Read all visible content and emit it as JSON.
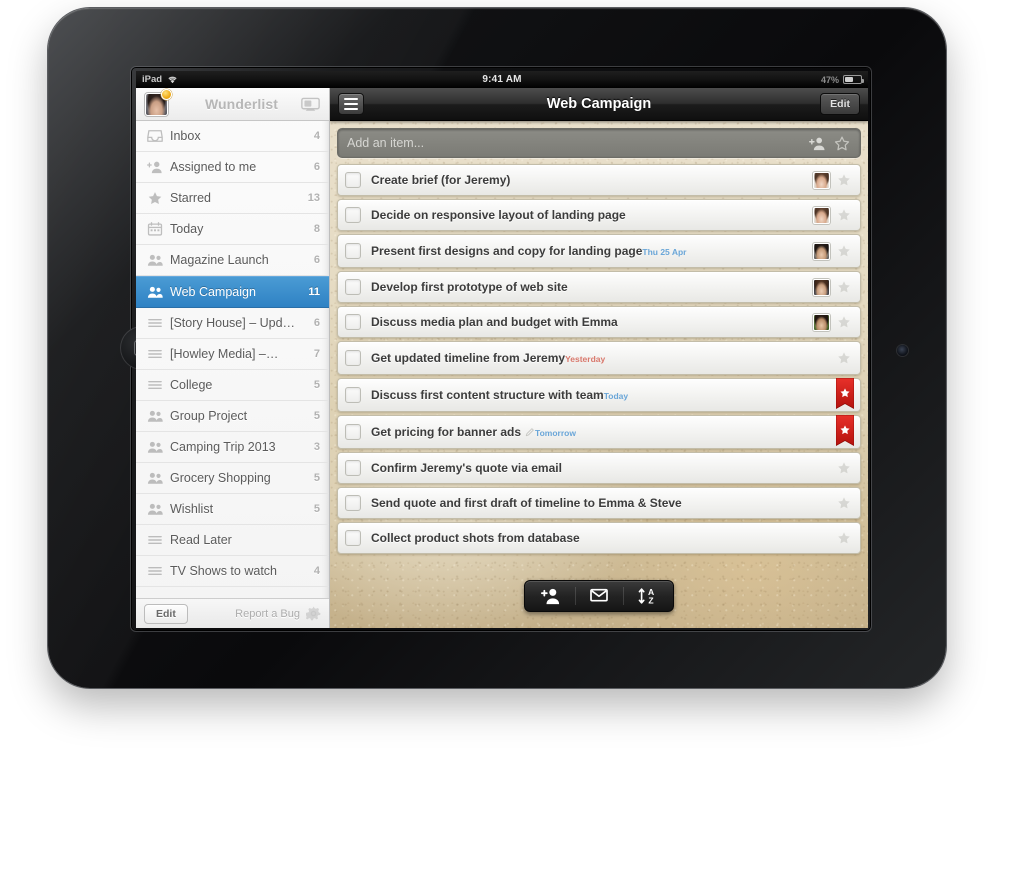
{
  "statusbar": {
    "carrier": "iPad",
    "wifi_icon": "wifi-icon",
    "time": "9:41 AM",
    "battery_percent": "47%",
    "battery_icon": "battery-icon"
  },
  "sidebar": {
    "app_title": "Wunderlist",
    "avatar_icon": "user-avatar",
    "badge_icon": "notification-badge",
    "screen_icon": "display-icon",
    "items": [
      {
        "label": "Inbox",
        "count": "4",
        "icon": "inbox-icon",
        "selected": false
      },
      {
        "label": "Assigned to me",
        "count": "6",
        "icon": "add-person-icon",
        "selected": false
      },
      {
        "label": "Starred",
        "count": "13",
        "icon": "star-icon",
        "selected": false
      },
      {
        "label": "Today",
        "count": "8",
        "icon": "calendar-icon",
        "selected": false
      },
      {
        "label": "Magazine Launch",
        "count": "6",
        "icon": "people-icon",
        "selected": false
      },
      {
        "label": "Web Campaign",
        "count": "11",
        "icon": "people-icon",
        "selected": true
      },
      {
        "label": "[Story House] – Upd…",
        "count": "6",
        "icon": "list-icon",
        "selected": false
      },
      {
        "label": "[Howley Media] –…",
        "count": "7",
        "icon": "list-icon",
        "selected": false
      },
      {
        "label": "College",
        "count": "5",
        "icon": "list-icon",
        "selected": false
      },
      {
        "label": "Group Project",
        "count": "5",
        "icon": "people-icon",
        "selected": false
      },
      {
        "label": "Camping Trip 2013",
        "count": "3",
        "icon": "people-icon",
        "selected": false
      },
      {
        "label": "Grocery Shopping",
        "count": "5",
        "icon": "people-icon",
        "selected": false
      },
      {
        "label": "Wishlist",
        "count": "5",
        "icon": "people-icon",
        "selected": false
      },
      {
        "label": "Read Later",
        "count": "",
        "icon": "list-icon",
        "selected": false
      },
      {
        "label": "TV Shows to watch",
        "count": "4",
        "icon": "list-icon",
        "selected": false
      }
    ],
    "footer": {
      "edit_label": "Edit",
      "report_bug_label": "Report a Bug",
      "gear_icon": "gear-icon"
    }
  },
  "main": {
    "menu_icon": "hamburger-menu-icon",
    "title": "Web Campaign",
    "edit_label": "Edit",
    "add_item": {
      "placeholder": "Add an item...",
      "value": "",
      "assign_icon": "add-person-icon",
      "star_icon": "star-icon"
    },
    "tasks": [
      {
        "title": "Create brief (for Jeremy)",
        "due": "",
        "due_type": "",
        "avatar": "av-a",
        "starred": false,
        "note": false
      },
      {
        "title": "Decide on responsive layout of landing page",
        "due": "",
        "due_type": "",
        "avatar": "av-a",
        "starred": false,
        "note": false
      },
      {
        "title": "Present first designs and copy for landing page",
        "due": "Thu 25 Apr",
        "due_type": "blue",
        "avatar": "av-b",
        "starred": false,
        "note": false
      },
      {
        "title": "Develop first prototype of web site",
        "due": "",
        "due_type": "",
        "avatar": "av-c",
        "starred": false,
        "note": false
      },
      {
        "title": "Discuss media plan and budget with Emma",
        "due": "",
        "due_type": "",
        "avatar": "av-d",
        "starred": false,
        "note": false
      },
      {
        "title": "Get updated timeline from Jeremy",
        "due": "Yesterday",
        "due_type": "red",
        "avatar": "",
        "starred": false,
        "note": false
      },
      {
        "title": "Discuss first content structure with team",
        "due": "Today",
        "due_type": "blue",
        "avatar": "",
        "starred": true,
        "note": false
      },
      {
        "title": "Get pricing for banner ads",
        "due": "Tomorrow",
        "due_type": "blue",
        "avatar": "",
        "starred": true,
        "note": true
      },
      {
        "title": "Confirm Jeremy's quote via email",
        "due": "",
        "due_type": "",
        "avatar": "",
        "starred": false,
        "note": false
      },
      {
        "title": "Send quote and first draft of timeline to Emma & Steve",
        "due": "",
        "due_type": "",
        "avatar": "",
        "starred": false,
        "note": false
      },
      {
        "title": "Collect product shots from database",
        "due": "",
        "due_type": "",
        "avatar": "",
        "starred": false,
        "note": false
      }
    ],
    "toolbar": [
      {
        "icon": "add-person-icon",
        "name": "share-list-button"
      },
      {
        "icon": "mail-icon",
        "name": "email-list-button"
      },
      {
        "icon": "sort-az-icon",
        "name": "sort-button"
      }
    ]
  },
  "colors": {
    "accent_blue": "#2f82c4",
    "star_red": "#d61b1b",
    "due_blue": "#6aa6d8",
    "due_red": "#d9786c"
  }
}
